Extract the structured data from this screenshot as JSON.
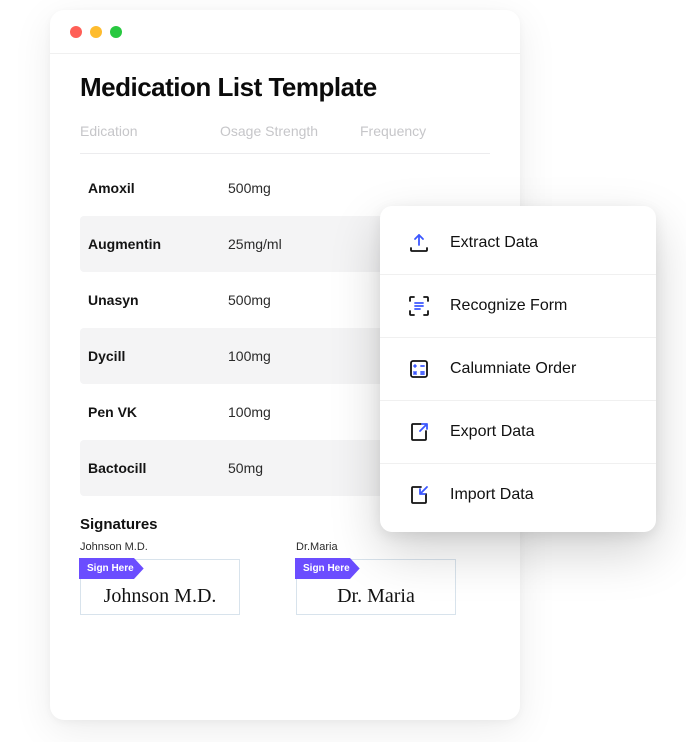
{
  "window": {
    "title": "Medication List Template",
    "columns": {
      "medication": "Edication",
      "dosage": "Osage Strength",
      "frequency": "Frequency"
    },
    "rows": [
      {
        "med": "Amoxil",
        "dose": "500mg"
      },
      {
        "med": "Augmentin",
        "dose": "25mg/ml"
      },
      {
        "med": "Unasyn",
        "dose": "500mg"
      },
      {
        "med": "Dycill",
        "dose": "100mg"
      },
      {
        "med": "Pen VK",
        "dose": "100mg"
      },
      {
        "med": "Bactocill",
        "dose": "50mg"
      }
    ],
    "signatures_label": "Signatures",
    "sign_here": "Sign Here",
    "signers": [
      {
        "name": "Johnson M.D.",
        "value": "Johnson M.D."
      },
      {
        "name": "Dr.Maria",
        "value": "Dr. Maria"
      }
    ]
  },
  "menu": {
    "items": [
      {
        "icon": "extract",
        "label": "Extract Data"
      },
      {
        "icon": "recognize",
        "label": "Recognize Form"
      },
      {
        "icon": "calculate",
        "label": "Calumniate Order"
      },
      {
        "icon": "export",
        "label": "Export Data"
      },
      {
        "icon": "import",
        "label": "Import Data"
      }
    ]
  },
  "colors": {
    "accent": "#3b57ff",
    "tag": "#6b4dff"
  }
}
